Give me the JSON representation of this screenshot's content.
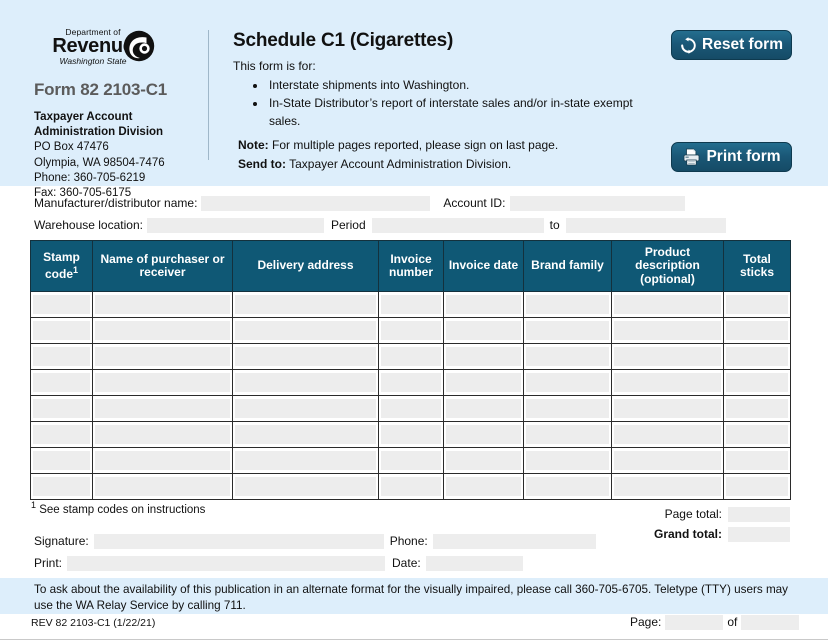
{
  "colors": {
    "band_blue": "#ddeefb",
    "table_header": "#0f5875",
    "button": "#1a5776",
    "field_fill": "#ededed",
    "form_number_gray": "#5b5b5b"
  },
  "agency": {
    "logo_dept": "Department of",
    "logo_name": "Revenue",
    "logo_state": "Washington State",
    "form_number": "Form 82 2103-C1",
    "division_line1": "Taxpayer Account",
    "division_line2": "Administration Division",
    "po_box": "PO Box 47476",
    "city_state_zip": "Olympia, WA 98504-7476",
    "phone": "Phone: 360-705-6219",
    "fax": "Fax: 360-705-6175"
  },
  "title_block": {
    "title": "Schedule C1 (Cigarettes)",
    "intro": "This form is for:",
    "bullets": [
      "Interstate shipments into Washington.",
      "In-State Distributor’s report of interstate sales and/or in-state exempt sales."
    ],
    "note_label": "Note:",
    "note_text": " For multiple pages reported, please sign on last page.",
    "sendto_label": "Send to:",
    "sendto_text": " Taxpayer Account Administration Division."
  },
  "buttons": {
    "reset": "Reset form",
    "print": "Print form"
  },
  "fields": {
    "manufacturer_label": "Manufacturer/distributor name:",
    "manufacturer_value": "",
    "account_id_label": "Account ID:",
    "account_id_value": "",
    "warehouse_label": "Warehouse location:",
    "warehouse_value": "",
    "period_label": "Period",
    "period_value": "",
    "to_label": "to",
    "period_to_value": ""
  },
  "table": {
    "headers": [
      "Stamp code",
      "Name of purchaser or receiver",
      "Delivery address",
      "Invoice number",
      "Invoice date",
      "Brand family",
      "Product description (optional)",
      "Total sticks"
    ],
    "header_stamp_line1": "Stamp",
    "header_stamp_line2": "code",
    "header_stamp_footnote_marker": "1",
    "header_name_line1": "Name of purchaser or",
    "header_name_line2": "receiver",
    "header_delivery": "Delivery address",
    "header_invnum_line1": "Invoice",
    "header_invnum_line2": "number",
    "header_invdate": "Invoice date",
    "header_brand": "Brand family",
    "header_product_line1": "Product",
    "header_product_line2": "description",
    "header_product_line3": "(optional)",
    "header_total_line1": "Total",
    "header_total_line2": "sticks",
    "row_count": 8,
    "rows": [
      [
        "",
        "",
        "",
        "",
        "",
        "",
        "",
        ""
      ],
      [
        "",
        "",
        "",
        "",
        "",
        "",
        "",
        ""
      ],
      [
        "",
        "",
        "",
        "",
        "",
        "",
        "",
        ""
      ],
      [
        "",
        "",
        "",
        "",
        "",
        "",
        "",
        ""
      ],
      [
        "",
        "",
        "",
        "",
        "",
        "",
        "",
        ""
      ],
      [
        "",
        "",
        "",
        "",
        "",
        "",
        "",
        ""
      ],
      [
        "",
        "",
        "",
        "",
        "",
        "",
        "",
        ""
      ],
      [
        "",
        "",
        "",
        "",
        "",
        "",
        "",
        ""
      ]
    ]
  },
  "footnote": {
    "marker": "1",
    "text": " See stamp codes on instructions"
  },
  "totals": {
    "page_total_label": "Page total:",
    "page_total_value": "",
    "grand_total_label": "Grand total:",
    "grand_total_value": ""
  },
  "signature": {
    "signature_label": "Signature:",
    "signature_value": "",
    "phone_label": "Phone:",
    "phone_value": "",
    "print_label": "Print:",
    "print_value": "",
    "date_label": "Date:",
    "date_value": ""
  },
  "footer": {
    "accessibility": "To ask about the availability of this publication in an alternate format for the visually impaired, please call 360-705-6705. Teletype (TTY) users may use the WA Relay Service by calling 711.",
    "revision": "REV 82 2103-C1 (1/22/21)",
    "page_label": "Page:",
    "page_value": "",
    "of_label": "of",
    "of_value": ""
  }
}
